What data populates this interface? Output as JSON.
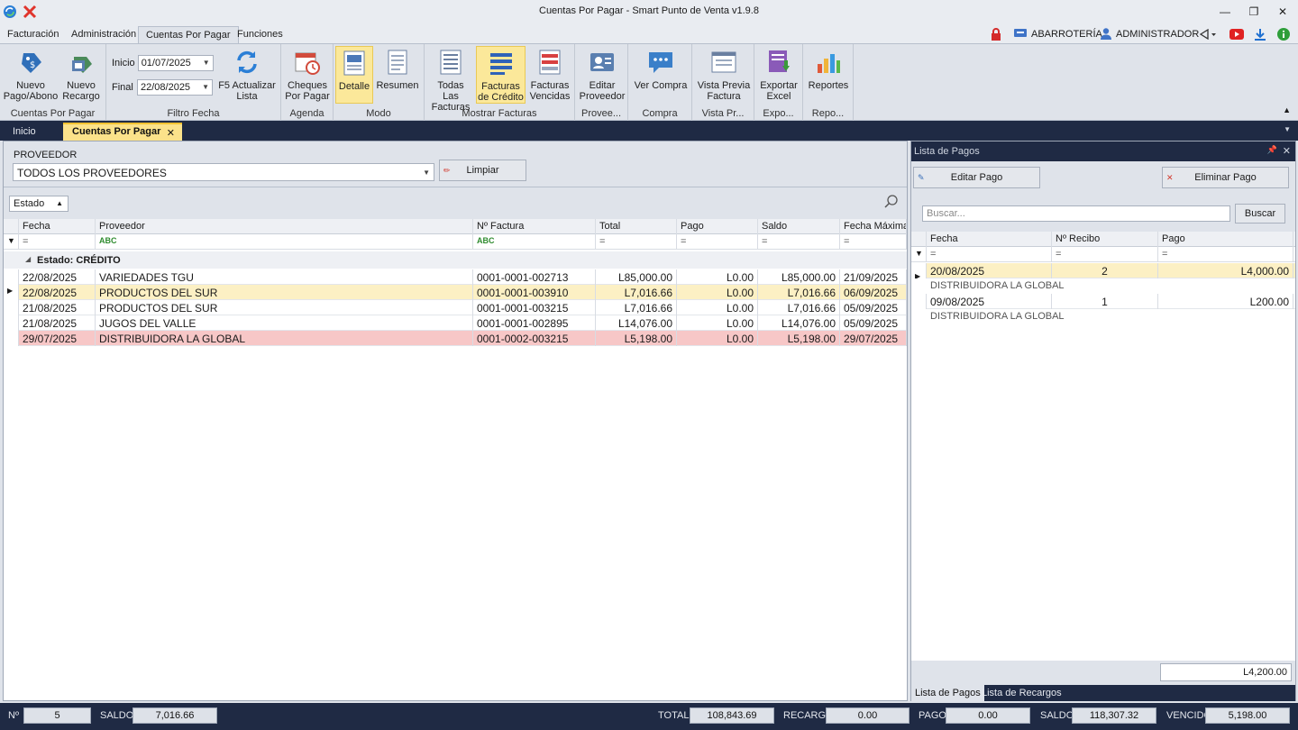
{
  "window": {
    "title": "Cuentas Por Pagar - Smart Punto de Venta v1.9.8"
  },
  "ribbon_tabs": [
    "Facturación",
    "Administración",
    "Cuentas Por Pagar",
    "Funciones"
  ],
  "user_bar": {
    "store": "ABARROTERÍA",
    "user": "ADMINISTRADOR"
  },
  "ribbon": {
    "nuevo_pago": "Nuevo Pago/Abono",
    "nuevo_recargo": "Nuevo Recargo",
    "group_cuentas": "Cuentas Por Pagar",
    "inicio_label": "Inicio",
    "inicio_value": "01/07/2025",
    "final_label": "Final",
    "final_value": "22/08/2025",
    "actualizar": "F5 Actualizar Lista",
    "group_filtro": "Filtro Fecha",
    "cheques": "Cheques Por Pagar",
    "group_agenda": "Agenda",
    "detalle": "Detalle",
    "resumen": "Resumen",
    "group_modo": "Modo",
    "todas": "Todas Las Facturas",
    "credito": "Facturas de Crédito",
    "vencidas": "Facturas Vencidas",
    "group_mostrar": "Mostrar Facturas",
    "editar_prov": "Editar Proveedor",
    "group_prov": "Provee...",
    "ver_compra": "Ver Compra",
    "group_compra": "Compra",
    "vista_previa": "Vista Previa Factura",
    "group_vista": "Vista Pr...",
    "exportar": "Exportar Excel",
    "group_expo": "Expo...",
    "reportes": "Reportes",
    "group_repo": "Repo..."
  },
  "doc_tabs": {
    "inicio": "Inicio",
    "active": "Cuentas Por Pagar"
  },
  "filter": {
    "proveedor_label": "PROVEEDOR",
    "proveedor_value": "TODOS LOS PROVEEDORES",
    "limpiar": "Limpiar",
    "group_chip": "Estado"
  },
  "grid": {
    "columns": [
      "Fecha",
      "Proveedor",
      "Nº Factura",
      "Total",
      "Pago",
      "Saldo",
      "Fecha Máxima"
    ],
    "group_label": "Estado: CRÉDITO",
    "rows": [
      {
        "fecha": "22/08/2025",
        "proveedor": "VARIEDADES TGU",
        "factura": "0001-0001-002713",
        "total": "L85,000.00",
        "pago": "L0.00",
        "saldo": "L85,000.00",
        "maxima": "21/09/2025"
      },
      {
        "fecha": "22/08/2025",
        "proveedor": "PRODUCTOS DEL SUR",
        "factura": "0001-0001-003910",
        "total": "L7,016.66",
        "pago": "L0.00",
        "saldo": "L7,016.66",
        "maxima": "06/09/2025"
      },
      {
        "fecha": "21/08/2025",
        "proveedor": "PRODUCTOS DEL SUR",
        "factura": "0001-0001-003215",
        "total": "L7,016.66",
        "pago": "L0.00",
        "saldo": "L7,016.66",
        "maxima": "05/09/2025"
      },
      {
        "fecha": "21/08/2025",
        "proveedor": "JUGOS DEL VALLE",
        "factura": "0001-0001-002895",
        "total": "L14,076.00",
        "pago": "L0.00",
        "saldo": "L14,076.00",
        "maxima": "05/09/2025"
      },
      {
        "fecha": "29/07/2025",
        "proveedor": "DISTRIBUIDORA LA GLOBAL",
        "factura": "0001-0002-003215",
        "total": "L5,198.00",
        "pago": "L0.00",
        "saldo": "L5,198.00",
        "maxima": "29/07/2025"
      }
    ]
  },
  "payments": {
    "title": "Lista de Pagos",
    "editar": "Editar Pago",
    "eliminar": "Eliminar Pago",
    "search_placeholder": "Buscar...",
    "buscar": "Buscar",
    "columns": [
      "Fecha",
      "Nº Recibo",
      "Pago"
    ],
    "rows": [
      {
        "fecha": "20/08/2025",
        "recibo": "2",
        "pago": "L4,000.00",
        "proveedor": "DISTRIBUIDORA LA GLOBAL"
      },
      {
        "fecha": "09/08/2025",
        "recibo": "1",
        "pago": "L200.00",
        "proveedor": "DISTRIBUIDORA LA GLOBAL"
      }
    ],
    "total": "L4,200.00",
    "tabs": [
      "Lista de Pagos",
      "Lista de Recargos"
    ]
  },
  "status": {
    "n_label": "Nº",
    "n_value": "5",
    "saldo_label": "SALDO",
    "saldo_value": "7,016.66",
    "total_label": "TOTAL",
    "total_value": "108,843.69",
    "recargo_label": "RECARGO",
    "recargo_value": "0.00",
    "pago_label": "PAGO",
    "pago_value": "0.00",
    "saldo2_label": "SALDO",
    "saldo2_value": "118,307.32",
    "vencido_label": "VENCIDO",
    "vencido_value": "5,198.00"
  }
}
